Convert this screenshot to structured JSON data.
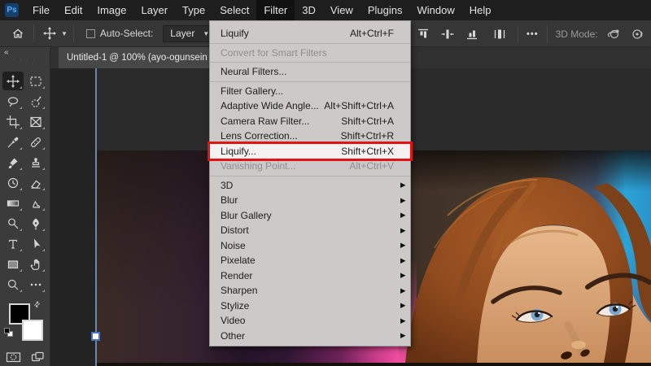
{
  "titlebar": {
    "logo": "Ps",
    "menus": [
      {
        "label": "File",
        "name": "menu-file",
        "ia": "true"
      },
      {
        "label": "Edit",
        "name": "menu-edit",
        "ia": "true"
      },
      {
        "label": "Image",
        "name": "menu-image",
        "ia": "true"
      },
      {
        "label": "Layer",
        "name": "menu-layer",
        "ia": "true"
      },
      {
        "label": "Type",
        "name": "menu-type",
        "ia": "true"
      },
      {
        "label": "Select",
        "name": "menu-select",
        "ia": "true"
      },
      {
        "label": "Filter",
        "cls": "active",
        "name": "menu-filter",
        "ia": "true"
      },
      {
        "label": "3D",
        "name": "menu-3d",
        "ia": "true"
      },
      {
        "label": "View",
        "name": "menu-view",
        "ia": "true"
      },
      {
        "label": "Plugins",
        "name": "menu-plugins",
        "ia": "true"
      },
      {
        "label": "Window",
        "name": "menu-window",
        "ia": "true"
      },
      {
        "label": "Help",
        "name": "menu-help",
        "ia": "true"
      }
    ]
  },
  "options_bar": {
    "auto_select_label": "Auto-Select:",
    "layer_dropdown_value": "Layer",
    "more_icon": "•••",
    "mode_label": "3D Mode:",
    "icons": [
      "home-icon",
      "move-tool-icon",
      "chevron-down-icon",
      "align-top-icon",
      "distribute-horizontal-icon",
      "align-bottom-icon",
      "distribute-center-icon",
      "more-options-icon",
      "orbit-3d-icon",
      "roll-3d-icon"
    ]
  },
  "tab": {
    "title": "Untitled-1 @ 100% (ayo-ogunsein"
  },
  "filter_menu": {
    "items": [
      {
        "label": "Liquify",
        "shortcut": "Alt+Ctrl+F",
        "name": "filter-menu-liquify-repeat",
        "ia": "true"
      },
      {
        "cls": "sep",
        "ia": "false"
      },
      {
        "label": "Convert for Smart Filters",
        "cls": "disabled",
        "name": "filter-menu-convert-smart-filters",
        "ia": "true"
      },
      {
        "cls": "sep",
        "ia": "false"
      },
      {
        "label": "Neural Filters...",
        "name": "filter-menu-neural-filters",
        "ia": "true"
      },
      {
        "cls": "sep",
        "ia": "false"
      },
      {
        "label": "Filter Gallery...",
        "name": "filter-menu-filter-gallery",
        "ia": "true"
      },
      {
        "label": "Adaptive Wide Angle...",
        "shortcut": "Alt+Shift+Ctrl+A",
        "name": "filter-menu-adaptive-wide-angle",
        "ia": "true"
      },
      {
        "label": "Camera Raw Filter...",
        "shortcut": "Shift+Ctrl+A",
        "name": "filter-menu-camera-raw-filter",
        "ia": "true"
      },
      {
        "label": "Lens Correction...",
        "shortcut": "Shift+Ctrl+R",
        "name": "filter-menu-lens-correction",
        "ia": "true"
      },
      {
        "label": "Liquify...",
        "shortcut": "Shift+Ctrl+X",
        "cls": "highlighted",
        "name": "filter-menu-liquify",
        "ia": "true"
      },
      {
        "label": "Vanishing Point...",
        "shortcut": "Alt+Ctrl+V",
        "cls": "disabled",
        "name": "filter-menu-vanishing-point",
        "ia": "true"
      },
      {
        "cls": "sep",
        "ia": "false"
      },
      {
        "label": "3D",
        "sub": "▶",
        "name": "filter-menu-3d",
        "ia": "true"
      },
      {
        "label": "Blur",
        "sub": "▶",
        "name": "filter-menu-blur",
        "ia": "true"
      },
      {
        "label": "Blur Gallery",
        "sub": "▶",
        "name": "filter-menu-blur-gallery",
        "ia": "true"
      },
      {
        "label": "Distort",
        "sub": "▶",
        "name": "filter-menu-distort",
        "ia": "true"
      },
      {
        "label": "Noise",
        "sub": "▶",
        "name": "filter-menu-noise",
        "ia": "true"
      },
      {
        "label": "Pixelate",
        "sub": "▶",
        "name": "filter-menu-pixelate",
        "ia": "true"
      },
      {
        "label": "Render",
        "sub": "▶",
        "name": "filter-menu-render",
        "ia": "true"
      },
      {
        "label": "Sharpen",
        "sub": "▶",
        "name": "filter-menu-sharpen",
        "ia": "true"
      },
      {
        "label": "Stylize",
        "sub": "▶",
        "name": "filter-menu-stylize",
        "ia": "true"
      },
      {
        "label": "Video",
        "sub": "▶",
        "name": "filter-menu-video",
        "ia": "true"
      },
      {
        "label": "Other",
        "sub": "▶",
        "name": "filter-menu-other",
        "ia": "true"
      }
    ]
  },
  "toolbar": {
    "collapse_icon": "«",
    "grip": "· · · ·",
    "swap_icon": "⇄",
    "tools": [
      "move-tool",
      "marquee-tool",
      "lasso-tool",
      "quick-selection-tool",
      "crop-tool",
      "frame-tool",
      "eyedropper-tool",
      "healing-brush-tool",
      "brush-tool",
      "clone-stamp-tool",
      "history-brush-tool",
      "eraser-tool",
      "gradient-tool",
      "smudge-tool",
      "dodge-tool",
      "pen-tool",
      "type-tool",
      "path-selection-tool",
      "shape-tool",
      "hand-tool",
      "zoom-tool",
      "edit-toolbar",
      "foreground-color",
      "background-color",
      "quick-mask-mode",
      "screen-mode"
    ]
  },
  "colors": {
    "accent_red": "#e21313",
    "guide_blue": "#6d87ac",
    "pink_glow": "#f14da0",
    "cyan_band": "#2ba4d8",
    "menu_bg": "#ccc9c8",
    "ui_dark": "#1e1e1e"
  }
}
